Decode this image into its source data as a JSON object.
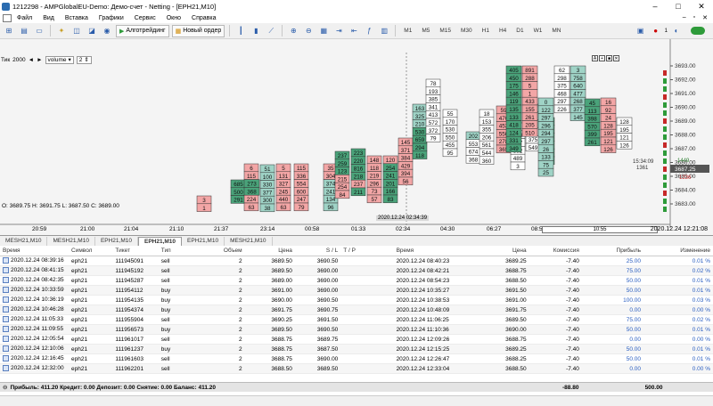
{
  "titlebar": {
    "title": "1212298 - AMPGlobalEU-Demo: Демо-счет - Netting - [EPH21,M10]"
  },
  "menu": {
    "items": [
      "Файл",
      "Вид",
      "Вставка",
      "Графики",
      "Сервис",
      "Окно",
      "Справка"
    ]
  },
  "toolbar": {
    "algo_label": "Алготрейдинг",
    "new_order_label": "Новый ордер",
    "timeframes": [
      "M1",
      "M5",
      "M15",
      "M30",
      "H1",
      "H4",
      "D1",
      "W1",
      "MN"
    ],
    "bell_count": "1"
  },
  "chartbar": {
    "label": "Тик",
    "value": "2000",
    "indicator": "volume",
    "param": "2"
  },
  "ohlc": "O: 3689.75  H: 3691.75  L: 3687.50  C: 3689.00",
  "price_axis": {
    "ticks": [
      "3693.00",
      "3692.00",
      "3691.00",
      "3690.00",
      "3689.00",
      "3688.00",
      "3687.00",
      "3686.00",
      "3685.00",
      "3684.00",
      "3683.00"
    ],
    "current": "3687.25",
    "bid": "3687.50",
    "bid_vol": "1449",
    "ask_vol": "1236",
    "countdown": "15:34:09",
    "countdown_vol": "1361"
  },
  "x_axis": {
    "labels": [
      "20:59",
      "21:00",
      "21:04",
      "21:10",
      "21:37",
      "23:14",
      "00:58",
      "01:33",
      "02:34",
      "04:30",
      "06:27",
      "08:53",
      "10:55"
    ],
    "highlight": "2020.12.24 02:34:39",
    "datetime": "2020.12.24 12:21:08"
  },
  "chart_tabs": [
    "MESH21,M10",
    "MESH21,M10",
    "EPH21,M10",
    "EPH21,M10",
    "EPH21,M10",
    "MESH21,M10"
  ],
  "table": {
    "headers": [
      "Время",
      "Символ",
      "Тикет",
      "Тип",
      "Объем",
      "Цена",
      "S / L",
      "T / P",
      "Время",
      "Цена",
      "Комиссия",
      "Прибыль",
      "Изменение"
    ],
    "rows": [
      [
        "2020.12.24 08:39:16",
        "eph21",
        "111945091",
        "sell",
        "2",
        "3689.50",
        "3690.50",
        "",
        "2020.12.24 08:40:23",
        "3689.25",
        "-7.40",
        "25.00",
        "0.01 %"
      ],
      [
        "2020.12.24 08:41:15",
        "eph21",
        "111945192",
        "sell",
        "2",
        "3689.50",
        "3690.00",
        "",
        "2020.12.24 08:42:21",
        "3688.75",
        "-7.40",
        "75.00",
        "0.02 %"
      ],
      [
        "2020.12.24 08:42:35",
        "eph21",
        "111945287",
        "sell",
        "2",
        "3689.00",
        "3690.00",
        "",
        "2020.12.24 08:54:23",
        "3688.50",
        "-7.40",
        "50.00",
        "0.01 %"
      ],
      [
        "2020.12.24 10:33:59",
        "eph21",
        "111954112",
        "buy",
        "2",
        "3691.00",
        "3690.00",
        "",
        "2020.12.24 10:35:27",
        "3691.50",
        "-7.40",
        "50.00",
        "0.01 %"
      ],
      [
        "2020.12.24 10:36:19",
        "eph21",
        "111954135",
        "buy",
        "2",
        "3690.00",
        "3690.50",
        "",
        "2020.12.24 10:38:53",
        "3691.00",
        "-7.40",
        "100.00",
        "0.03 %"
      ],
      [
        "2020.12.24 10:46:28",
        "eph21",
        "111954374",
        "buy",
        "2",
        "3691.75",
        "3690.75",
        "",
        "2020.12.24 10:48:09",
        "3691.75",
        "-7.40",
        "0.00",
        "0.00 %"
      ],
      [
        "2020.12.24 11:05:33",
        "eph21",
        "111955904",
        "sell",
        "2",
        "3690.25",
        "3691.50",
        "",
        "2020.12.24 11:06:25",
        "3689.50",
        "-7.40",
        "75.00",
        "0.02 %"
      ],
      [
        "2020.12.24 11:09:55",
        "eph21",
        "111956573",
        "buy",
        "2",
        "3689.50",
        "3690.50",
        "",
        "2020.12.24 11:10:36",
        "3690.00",
        "-7.40",
        "50.00",
        "0.01 %"
      ],
      [
        "2020.12.24 12:05:54",
        "eph21",
        "111961017",
        "sell",
        "2",
        "3688.75",
        "3689.75",
        "",
        "2020.12.24 12:09:26",
        "3688.75",
        "-7.40",
        "0.00",
        "0.00 %"
      ],
      [
        "2020.12.24 12:10:06",
        "eph21",
        "111961237",
        "buy",
        "2",
        "3688.75",
        "3687.50",
        "",
        "2020.12.24 12:15:25",
        "3689.25",
        "-7.40",
        "50.00",
        "0.01 %"
      ],
      [
        "2020.12.24 12:16:45",
        "eph21",
        "111961603",
        "sell",
        "2",
        "3688.75",
        "3690.00",
        "",
        "2020.12.24 12:26:47",
        "3688.25",
        "-7.40",
        "50.00",
        "0.01 %"
      ],
      [
        "2020.12.24 12:32:00",
        "eph21",
        "111962201",
        "sell",
        "2",
        "3688.50",
        "3689.50",
        "",
        "2020.12.24 12:33:04",
        "3688.50",
        "-7.40",
        "0.00",
        "0.00 %"
      ]
    ]
  },
  "totals": {
    "summary": "Прибыль: 411.20  Кредит: 0.00  Депозит: 0.00  Снятие: 0.00  Баланс: 411.20",
    "commission": "-88.80",
    "profit": "500.00"
  },
  "clusters": [
    {
      "col": 0,
      "cells": [
        [
          "3",
          1,
          "r"
        ],
        [
          "1",
          1,
          "r"
        ]
      ]
    },
    {
      "col": 1,
      "cells": [
        [
          "685",
          2,
          "g"
        ],
        [
          "500",
          2,
          "g"
        ],
        [
          "291",
          2,
          "g"
        ]
      ]
    },
    {
      "col": 2,
      "cells": [
        [
          "6",
          1,
          "r"
        ],
        [
          "115",
          1,
          "r"
        ],
        [
          "273",
          2,
          "g"
        ],
        [
          "368",
          2,
          "g"
        ],
        [
          "224",
          1,
          "r"
        ],
        [
          "63",
          1,
          "r"
        ]
      ]
    },
    {
      "col": 3,
      "cells": [
        [
          "51",
          1,
          "t"
        ],
        [
          "100",
          1,
          "t"
        ],
        [
          "330",
          1,
          "t"
        ],
        [
          "377",
          1,
          "t"
        ],
        [
          "300",
          1,
          "t"
        ],
        [
          "38",
          1,
          "t"
        ]
      ]
    },
    {
      "col": 4,
      "cells": [
        [
          "5",
          1,
          "r"
        ],
        [
          "131",
          1,
          "r"
        ],
        [
          "327",
          1,
          "r"
        ],
        [
          "245",
          1,
          "r"
        ],
        [
          "440",
          1,
          "r"
        ],
        [
          "63",
          1,
          "r"
        ]
      ]
    },
    {
      "col": 5,
      "cells": [
        [
          "115",
          1,
          "r"
        ],
        [
          "336",
          1,
          "r"
        ],
        [
          "554",
          1,
          "r"
        ],
        [
          "600",
          1,
          "r"
        ],
        [
          "247",
          1,
          "r"
        ],
        [
          "79",
          1,
          "r"
        ]
      ]
    },
    {
      "col": 6,
      "cells": [
        [
          "35",
          1,
          "r"
        ],
        [
          "304",
          1,
          "r"
        ],
        [
          "374",
          1,
          "t"
        ],
        [
          "241",
          1,
          "t"
        ],
        [
          "134",
          1,
          "t"
        ],
        [
          "96",
          1,
          "t"
        ]
      ]
    },
    {
      "col": 7,
      "cells": [
        [
          "237",
          1,
          "g"
        ],
        [
          "259",
          1,
          "g"
        ],
        [
          "123",
          1,
          "g"
        ],
        [
          "215",
          1,
          "r"
        ],
        [
          "254",
          1,
          "r"
        ],
        [
          "84",
          1,
          "r"
        ]
      ]
    },
    {
      "col": 8,
      "cells": [
        [
          "223",
          1,
          "g"
        ],
        [
          "220",
          1,
          "g"
        ],
        [
          "816",
          1,
          "g"
        ],
        [
          "218",
          1,
          "g"
        ],
        [
          "237",
          1,
          "r"
        ],
        [
          "211",
          1,
          "g"
        ]
      ]
    },
    {
      "col": 9,
      "cells": [
        [
          "148",
          1,
          "r"
        ],
        [
          "118",
          1,
          "r"
        ],
        [
          "219",
          1,
          "r"
        ],
        [
          "296",
          1,
          "r"
        ],
        [
          "73",
          1,
          "r"
        ],
        [
          "57",
          1,
          "r"
        ]
      ]
    },
    {
      "col": 10,
      "cells": [
        [
          "120",
          1,
          "r"
        ],
        [
          "254",
          1,
          "g"
        ],
        [
          "241",
          1,
          "g"
        ],
        [
          "201",
          1,
          "g"
        ],
        [
          "166",
          1,
          "g"
        ],
        [
          "83",
          1,
          "g"
        ]
      ]
    },
    {
      "col": 11,
      "cells": [
        [
          "145",
          1,
          "r"
        ],
        [
          "371",
          1,
          "r"
        ],
        [
          "384",
          1,
          "r"
        ],
        [
          "429",
          1,
          "r"
        ],
        [
          "394",
          1,
          "r"
        ],
        [
          "56",
          1,
          "r"
        ]
      ]
    },
    {
      "col": 12,
      "cells": [
        [
          "163",
          1,
          "t"
        ],
        [
          "325",
          1,
          "t"
        ],
        [
          "210",
          1,
          "t"
        ],
        [
          "530",
          1,
          "g"
        ],
        [
          "659",
          1,
          "g"
        ],
        [
          "294",
          1,
          "g"
        ],
        [
          "118",
          1,
          "g"
        ]
      ]
    },
    {
      "col": 13,
      "cells": [
        [
          "78",
          1,
          "w"
        ],
        [
          "193",
          1,
          "w"
        ],
        [
          "385",
          1,
          "w"
        ],
        [
          "341",
          1,
          "w"
        ],
        [
          "413",
          1,
          "w"
        ],
        [
          "572",
          1,
          "w"
        ],
        [
          "372",
          1,
          "w"
        ],
        [
          "79",
          1,
          "w"
        ]
      ]
    },
    {
      "col": 14,
      "cells": [
        [
          "55",
          1,
          "w"
        ],
        [
          "170",
          1,
          "w"
        ],
        [
          "530",
          1,
          "w"
        ],
        [
          "550",
          1,
          "w"
        ],
        [
          "455",
          1,
          "w"
        ],
        [
          "95",
          1,
          "w"
        ]
      ]
    },
    {
      "col": 15,
      "cells": [
        [
          "202",
          1,
          "t"
        ],
        [
          "553",
          1,
          "w"
        ],
        [
          "674",
          1,
          "w"
        ],
        [
          "368",
          1,
          "w"
        ]
      ]
    },
    {
      "col": 16,
      "cells": [
        [
          "18",
          1,
          "w"
        ],
        [
          "153",
          1,
          "w"
        ],
        [
          "355",
          1,
          "w"
        ],
        [
          "206",
          1,
          "w"
        ],
        [
          "561",
          1,
          "w"
        ],
        [
          "544",
          1,
          "w"
        ],
        [
          "360",
          1,
          "w"
        ]
      ]
    },
    {
      "col": 17,
      "cells": [
        [
          "59",
          1,
          "r"
        ],
        [
          "470",
          1,
          "r"
        ],
        [
          "453",
          1,
          "r"
        ],
        [
          "550",
          1,
          "r"
        ],
        [
          "278",
          1,
          "r"
        ],
        [
          "365",
          1,
          "r"
        ]
      ]
    },
    {
      "col": 18,
      "cells": [
        [
          "3",
          1,
          "w"
        ],
        [
          "168",
          1,
          "w"
        ],
        [
          "157",
          1,
          "w"
        ],
        [
          "392",
          1,
          "w"
        ],
        [
          "489",
          1,
          "w"
        ],
        [
          "3",
          1,
          "w"
        ]
      ]
    },
    {
      "col": 19,
      "cells": [
        [
          "15",
          1,
          "t"
        ],
        [
          "124",
          1,
          "t"
        ],
        [
          "828",
          1,
          "t"
        ],
        [
          "784",
          1,
          "w"
        ],
        [
          "375",
          1,
          "w"
        ],
        [
          "549",
          1,
          "w"
        ]
      ]
    },
    {
      "col": 20,
      "cells": [
        [
          "45",
          1,
          "g"
        ],
        [
          "46",
          1,
          "g"
        ],
        [
          "159",
          1,
          "g"
        ],
        [
          "559",
          1,
          "g"
        ],
        [
          "339",
          1,
          "g"
        ],
        [
          "31",
          1,
          "g"
        ]
      ]
    }
  ]
}
